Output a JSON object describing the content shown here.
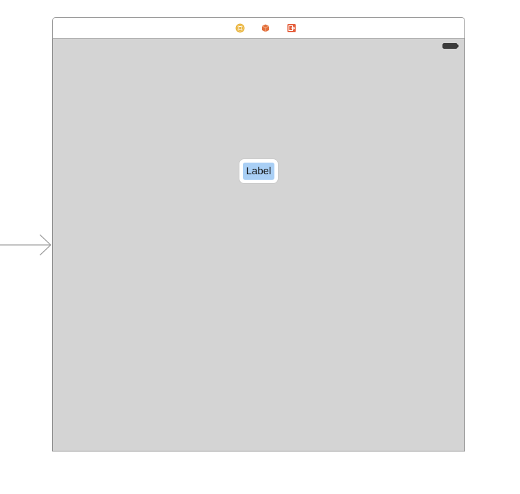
{
  "scene": {
    "dock_icons": [
      {
        "name": "view-controller-icon",
        "color": "#e8b13a"
      },
      {
        "name": "first-responder-icon",
        "color": "#e2703d"
      },
      {
        "name": "exit-icon",
        "color": "#e5603e"
      }
    ],
    "canvas_background": "#d4d4d4",
    "status_bar_icon": "battery-icon"
  },
  "label": {
    "text": "Label",
    "highlight_color": "#a9cff5"
  },
  "entry_point_icon": "initial-view-controller-arrow-icon"
}
